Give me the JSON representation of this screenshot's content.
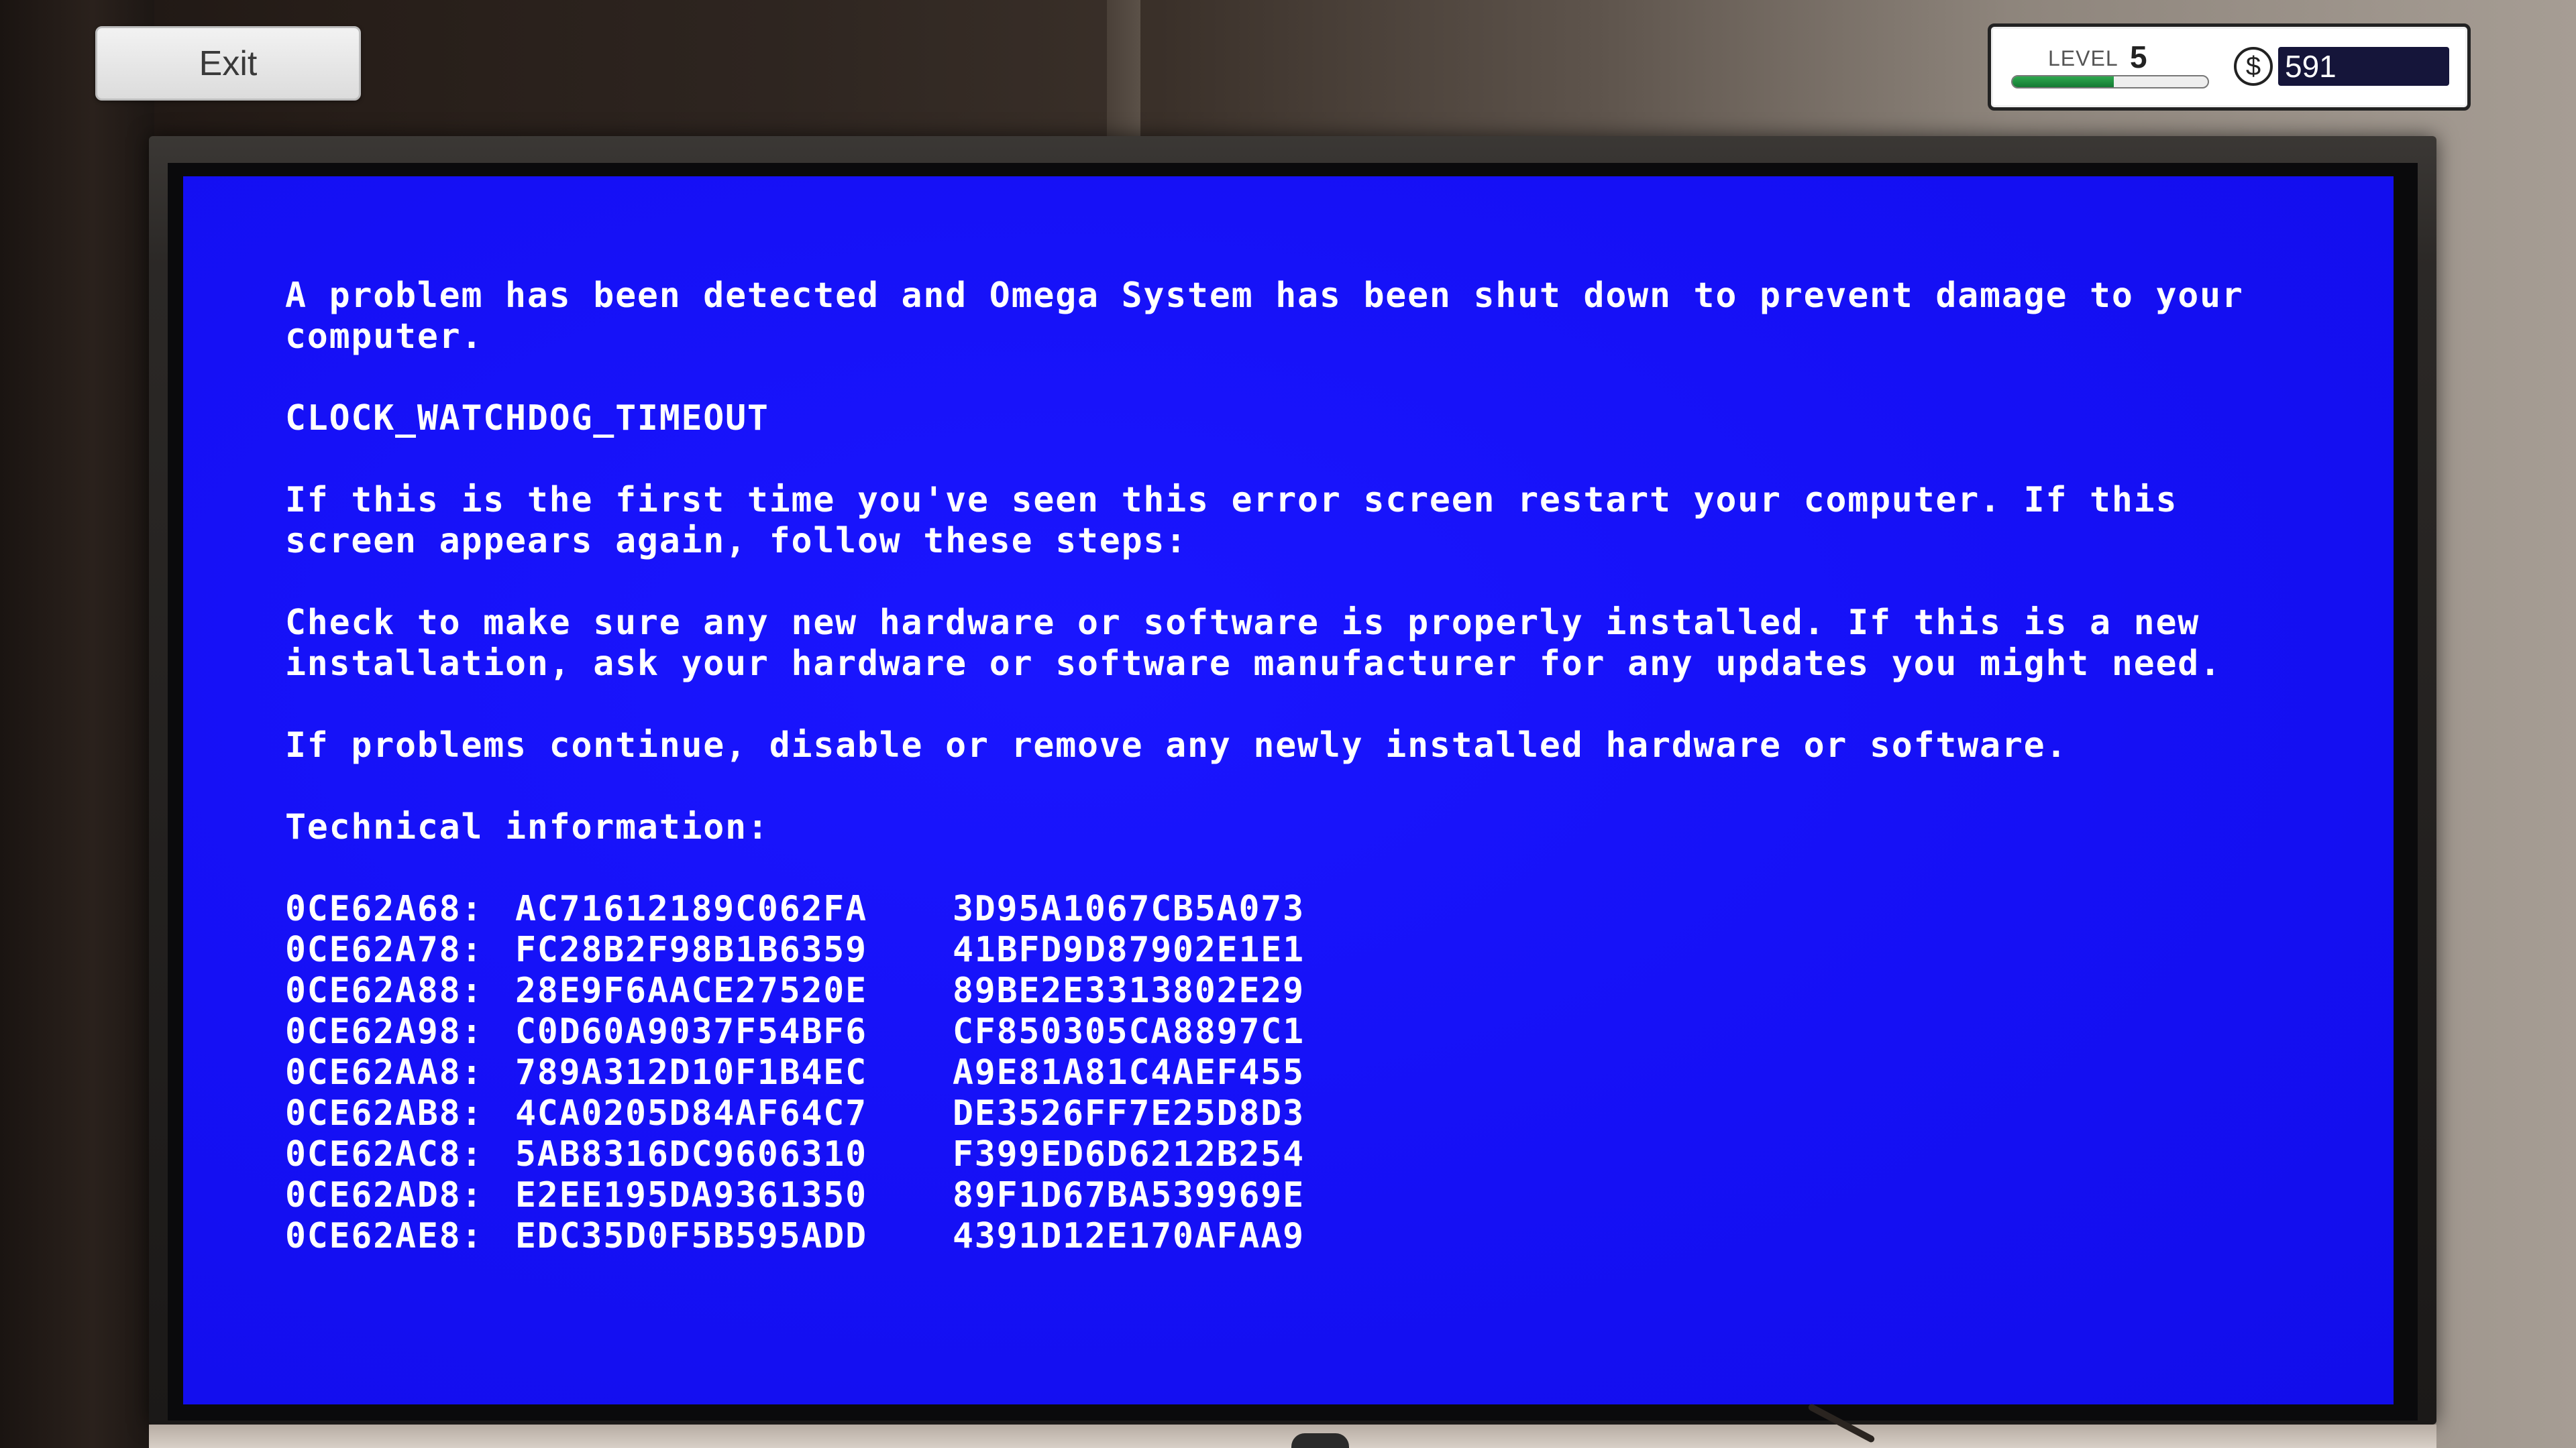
{
  "hud": {
    "exit_label": "Exit",
    "level_label": "LEVEL",
    "level_value": "5",
    "level_progress": 0.52,
    "currency_symbol": "$",
    "money": "591",
    "colors": {
      "progress": "#1f8f3f",
      "money_bg": "#15153a"
    }
  },
  "bsod": {
    "background": "#1510f5",
    "intro": "A problem has been detected and Omega System has been shut down to prevent damage to your computer.",
    "error_code": "CLOCK_WATCHDOG_TIMEOUT",
    "first_time": "If this is the first time you've seen this error screen restart your computer. If this screen appears again, follow these steps:",
    "check": "Check to make sure any new hardware or software is properly installed. If this is a new installation, ask your hardware or software manufacturer for any updates you might need.",
    "problems_continue": "If problems continue, disable or remove any newly installed hardware or software.",
    "tech_header": "Technical information:",
    "dump": [
      {
        "addr": "0CE62A68:",
        "v1": "AC71612189C062FA",
        "v2": "3D95A1067CB5A073"
      },
      {
        "addr": "0CE62A78:",
        "v1": "FC28B2F98B1B6359",
        "v2": "41BFD9D87902E1E1"
      },
      {
        "addr": "0CE62A88:",
        "v1": "28E9F6AACE27520E",
        "v2": "89BE2E3313802E29"
      },
      {
        "addr": "0CE62A98:",
        "v1": "C0D60A9037F54BF6",
        "v2": "CF850305CA8897C1"
      },
      {
        "addr": "0CE62AA8:",
        "v1": "789A312D10F1B4EC",
        "v2": "A9E81A81C4AEF455"
      },
      {
        "addr": "0CE62AB8:",
        "v1": "4CA0205D84AF64C7",
        "v2": "DE3526FF7E25D8D3"
      },
      {
        "addr": "0CE62AC8:",
        "v1": "5AB8316DC9606310",
        "v2": "F399ED6D6212B254"
      },
      {
        "addr": "0CE62AD8:",
        "v1": "E2EE195DA9361350",
        "v2": "89F1D67BA539969E"
      },
      {
        "addr": "0CE62AE8:",
        "v1": "EDC35D0F5B595ADD",
        "v2": "4391D12E170AFAA9"
      }
    ]
  }
}
